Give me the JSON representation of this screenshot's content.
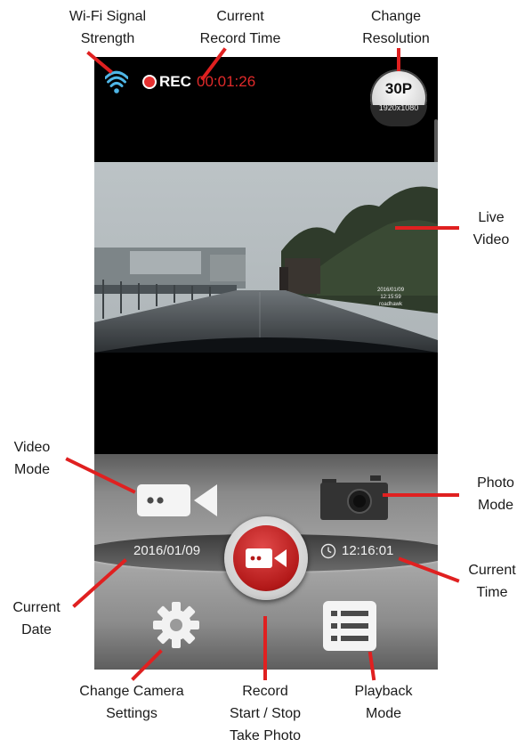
{
  "status_bar": {
    "rec_label": "REC",
    "record_time": "00:01:26",
    "resolution_main": "30P",
    "resolution_sub": "1920x1080"
  },
  "video_overlay": {
    "line1": "2016/01/09",
    "line2": "12:15:59",
    "line3": "roadhawk"
  },
  "controls": {
    "date": "2016/01/09",
    "time": "12:16:01"
  },
  "annotations": {
    "wifi_signal": [
      "Wi-Fi Signal",
      "Strength"
    ],
    "current_record_time": [
      "Current",
      "Record Time"
    ],
    "change_resolution": [
      "Change",
      "Resolution"
    ],
    "live_video": [
      "Live",
      "Video"
    ],
    "video_mode": [
      "Video",
      "Mode"
    ],
    "photo_mode": [
      "Photo",
      "Mode"
    ],
    "current_time": [
      "Current",
      "Time"
    ],
    "current_date": [
      "Current",
      "Date"
    ],
    "change_camera_settings": [
      "Change Camera",
      "Settings"
    ],
    "record": [
      "Record",
      "Start / Stop",
      "Take Photo"
    ],
    "playback_mode": [
      "Playback",
      "Mode"
    ]
  },
  "icons": {
    "wifi": "wifi-icon",
    "rec_dot": "record-dot-icon",
    "video_camera": "video-camera-icon",
    "photo_camera": "photo-camera-icon",
    "clock": "clock-icon",
    "gear": "gear-icon",
    "list": "list-icon"
  },
  "colors": {
    "leader_red": "#e02020",
    "rec_red": "#e02a2a",
    "wifi_blue": "#4fb6e6",
    "record_button_red": "#b31919"
  }
}
